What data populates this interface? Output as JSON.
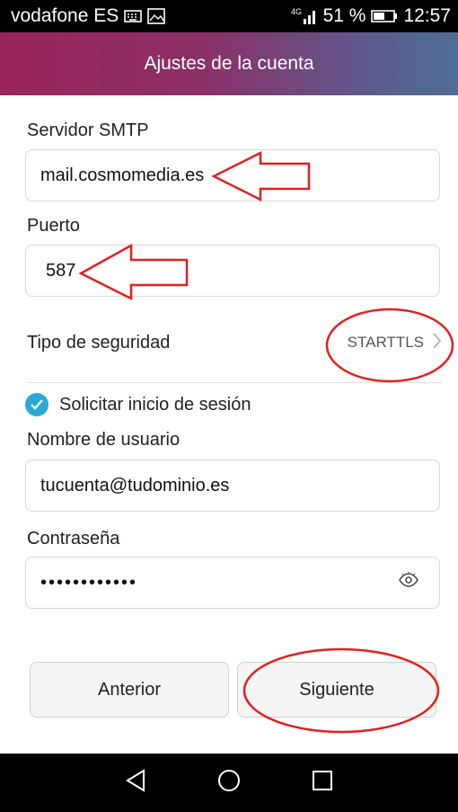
{
  "status_bar": {
    "carrier": "vodafone ES",
    "network": "4G",
    "battery": "51 %",
    "time": "12:57"
  },
  "app_bar": {
    "title": "Ajustes de la cuenta"
  },
  "form": {
    "smtp_label": "Servidor SMTP",
    "smtp_value": "mail.cosmomedia.es",
    "port_label": "Puerto",
    "port_value": "587",
    "security_label": "Tipo de seguridad",
    "security_value": "STARTTLS",
    "require_login_label": "Solicitar inicio de sesión",
    "require_login_checked": true,
    "username_label": "Nombre de usuario",
    "username_value": "tucuenta@tudominio.es",
    "password_label": "Contraseña",
    "password_value": "••••••••••••"
  },
  "buttons": {
    "previous": "Anterior",
    "next": "Siguiente"
  },
  "colors": {
    "accent": "#2ba8d6",
    "annotation": "#e02020"
  },
  "icons": [
    "keyboard-icon",
    "image-icon",
    "signal-icon",
    "battery-icon",
    "chevron-right-icon",
    "check-icon",
    "eye-icon",
    "back-icon",
    "home-icon",
    "recents-icon"
  ]
}
